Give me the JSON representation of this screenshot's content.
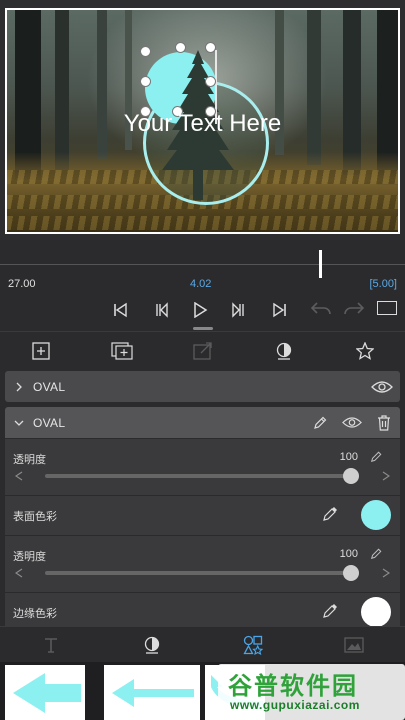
{
  "preview": {
    "caption": "Your Text Here"
  },
  "timeline": {
    "left_time": "27.00",
    "current_time": "4.02",
    "right_time": "[5.00]",
    "accent_color": "#5aa9e6"
  },
  "toolbar": {
    "icons": [
      "add-icon",
      "add-layer-icon",
      "export-icon",
      "mask-icon",
      "star-icon"
    ]
  },
  "layers": [
    {
      "name": "OVAL",
      "collapsed": true
    },
    {
      "name": "OVAL",
      "collapsed": false
    }
  ],
  "properties": {
    "opacity_label": "透明度",
    "opacity_value": "100",
    "opacity_fraction": 1.0,
    "fill_color_label": "表面色彩",
    "fill_color": "#8ceff0",
    "opacity2_label": "透明度",
    "opacity2_value": "100",
    "opacity2_fraction": 1.0,
    "stroke_color_label": "边缘色彩",
    "stroke_color": "#ffffff"
  },
  "bottom_tabs": [
    "text-icon",
    "mask-icon",
    "shapes-icon",
    "image-icon"
  ],
  "watermark": {
    "main": "谷普软件园",
    "sub": "www.gupuxiazai.com"
  }
}
